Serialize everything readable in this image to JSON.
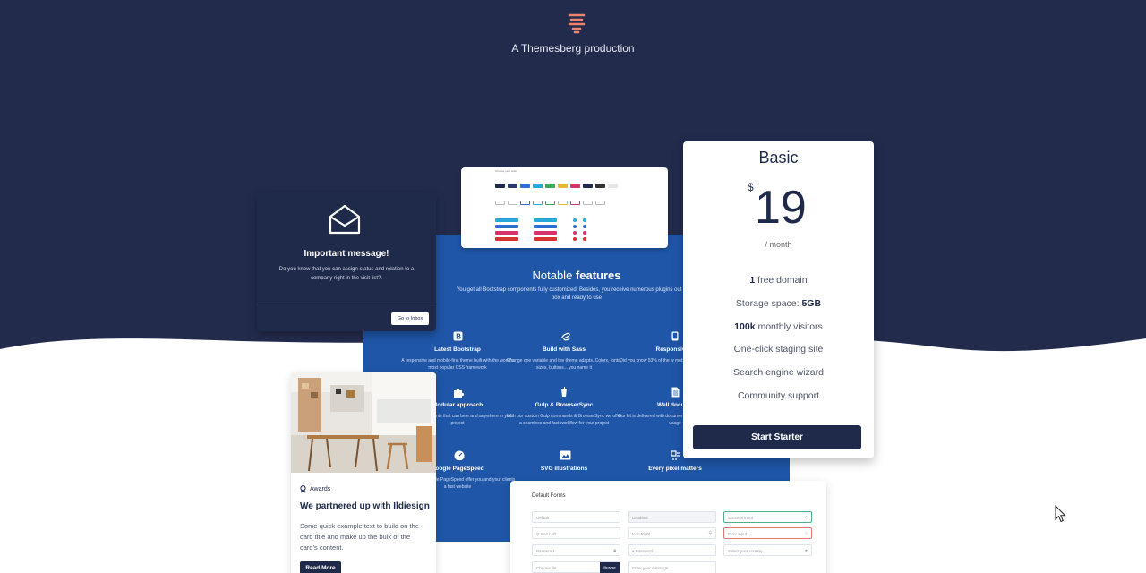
{
  "header": {
    "logo": "themesberg-logo-icon",
    "tagline": "A Themesberg production"
  },
  "colors": {
    "navy": "#232b4d",
    "blue_panel": "#1f56a8",
    "accent_orange": "#f0836a",
    "card_dark": "#1f2a4a"
  },
  "features": {
    "title_plain": "Notable",
    "title_bold": "features",
    "lead": "You get all Bootstrap components fully customized. Besides, you receive numerous plugins out of the box and ready to use",
    "items": [
      {
        "icon": "bootstrap-icon",
        "title": "Latest Bootstrap",
        "desc": "A responsive and mobile-first theme built with the world's most popular CSS framework"
      },
      {
        "icon": "sass-icon",
        "title": "Build with Sass",
        "desc": "Change one variable and the theme adapts. Colors, fonts, sizes, buttons... you name it"
      },
      {
        "icon": "mobile-icon",
        "title": "Responsive D",
        "desc": "Did you know 53% of the w mobile? Pixel is fully respon"
      },
      {
        "icon": "puzzle-icon",
        "title": "Modular approach",
        "desc": "omized components that can be e and anywhere in your project"
      },
      {
        "icon": "gulp-icon",
        "title": "Gulp & BrowserSync",
        "desc": "With our custom Gulp commands & BrowserSync we offer a seamless and fast workflow for your project"
      },
      {
        "icon": "document-icon",
        "title": "Well docume",
        "desc": "Our kit is delivered with documentation, describing all and usage"
      },
      {
        "icon": "speedometer-icon",
        "title": "Google PageSpeed",
        "desc": "0+ score on Google PageSpeed offer you and your clients a fast website"
      },
      {
        "icon": "image-icon",
        "title": "SVG illustrations",
        "desc": ""
      },
      {
        "icon": "pixel-icon",
        "title": "Every pixel matters",
        "desc": ""
      }
    ]
  },
  "buttons_preview": {
    "title": "Choose your color"
  },
  "message_card": {
    "icon": "envelope-open-icon",
    "title": "Important message!",
    "text": "Do you know that you can assign status and relation to a company right in the visit list?.",
    "button": "Go to Inbox"
  },
  "pricing": {
    "plan": "Basic",
    "currency": "$",
    "amount": "19",
    "period": "/ month",
    "features": [
      {
        "bold": "1",
        "text": " free domain",
        "bold_after": ""
      },
      {
        "bold": "",
        "text": "Storage space: ",
        "bold_after": "5GB"
      },
      {
        "bold": "100k",
        "text": " monthly visitors",
        "bold_after": ""
      },
      {
        "bold": "",
        "text": "One-click staging site",
        "bold_after": ""
      },
      {
        "bold": "",
        "text": "Search engine wizard",
        "bold_after": ""
      },
      {
        "bold": "",
        "text": "Community support",
        "bold_after": ""
      }
    ],
    "cta": "Start Starter"
  },
  "blog_card": {
    "badge_icon": "award-icon",
    "badge": "Awards",
    "title": "We partnered up with Ildiesign",
    "text": "Some quick example text to build on the card title and make up the bulk of the card's content.",
    "button": "Read More"
  },
  "forms_card": {
    "title": "Default Forms",
    "fields": [
      {
        "placeholder": "Default",
        "kind": "normal"
      },
      {
        "placeholder": "Disabled",
        "kind": "disabled"
      },
      {
        "placeholder": "Success input",
        "kind": "success"
      },
      {
        "placeholder": "Icon Left",
        "kind": "icon-left"
      },
      {
        "placeholder": "Icon Right",
        "kind": "icon-right"
      },
      {
        "placeholder": "Error input",
        "kind": "error"
      },
      {
        "placeholder": "Password",
        "kind": "password"
      },
      {
        "placeholder": "Password",
        "kind": "password-left"
      },
      {
        "placeholder": "Select your country",
        "kind": "select"
      },
      {
        "placeholder": "Choose file",
        "kind": "file"
      },
      {
        "placeholder": "Enter your message...",
        "kind": "textarea"
      }
    ],
    "browse": "Browse"
  }
}
